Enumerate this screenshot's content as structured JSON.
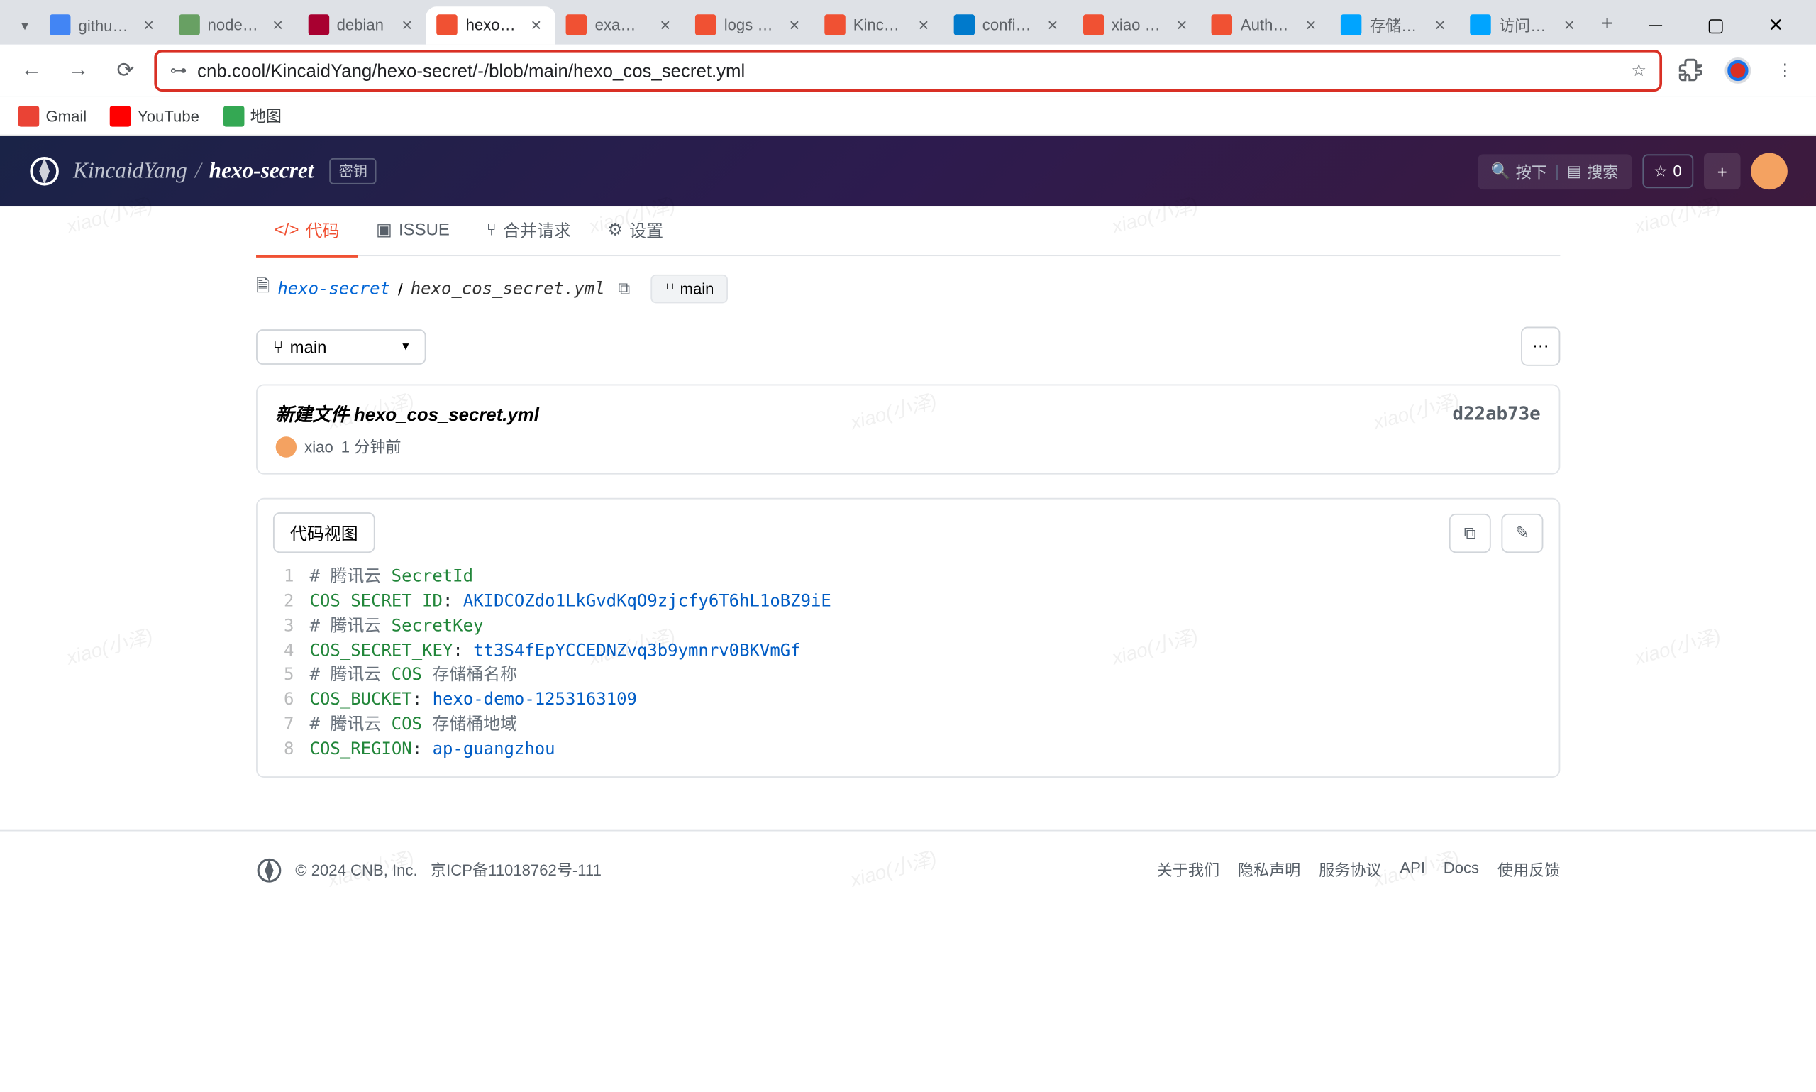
{
  "browser": {
    "tabs": [
      {
        "title": "github发",
        "favicon": "#4285f4"
      },
      {
        "title": "node Tao",
        "favicon": "#68a063"
      },
      {
        "title": "debian",
        "favicon": "#a80030"
      },
      {
        "title": "hexo co",
        "favicon": "#f05133",
        "active": true
      },
      {
        "title": "example",
        "favicon": "#f05133"
      },
      {
        "title": "logs · Kin",
        "favicon": "#f05133"
      },
      {
        "title": "KincaidY",
        "favicon": "#f05133"
      },
      {
        "title": "config.y",
        "favicon": "#007acc"
      },
      {
        "title": "xiao · re",
        "favicon": "#f05133"
      },
      {
        "title": "Authent",
        "favicon": "#f05133"
      },
      {
        "title": "存储桶列",
        "favicon": "#00a4ff"
      },
      {
        "title": "访问密钥",
        "favicon": "#00a4ff"
      }
    ],
    "url": "cnb.cool/KincaidYang/hexo-secret/-/blob/main/hexo_cos_secret.yml",
    "bookmarks": [
      {
        "label": "Gmail",
        "color": "#ea4335"
      },
      {
        "label": "YouTube",
        "color": "#ff0000"
      },
      {
        "label": "地图",
        "color": "#34a853"
      }
    ]
  },
  "header": {
    "owner": "KincaidYang",
    "repo": "hexo-secret",
    "badge": "密钥",
    "btn_down": "按下",
    "btn_search": "搜索",
    "star_count": "0"
  },
  "tabs": {
    "code": "代码",
    "issue": "ISSUE",
    "merge": "合并请求",
    "settings": "设置"
  },
  "file_path": {
    "repo": "hexo-secret",
    "file": "hexo_cos_secret.yml",
    "branch": "main"
  },
  "branch_select": "main",
  "commit": {
    "title": "新建文件 hexo_cos_secret.yml",
    "hash": "d22ab73e",
    "author": "xiao",
    "time": "1 分钟前"
  },
  "file_view": {
    "toggle": "代码视图"
  },
  "code": {
    "lines": [
      {
        "n": "1",
        "raw": "# 腾讯云 SecretId"
      },
      {
        "n": "2",
        "key": "COS_SECRET_ID",
        "val": "AKIDCOZdo1LkGvdKqO9zjcfy6T6hL1oBZ9iE"
      },
      {
        "n": "3",
        "raw": "# 腾讯云 SecretKey"
      },
      {
        "n": "4",
        "key": "COS_SECRET_KEY",
        "val": "tt3S4fEpYCCEDNZvq3b9ymnrv0BKVmGf"
      },
      {
        "n": "5",
        "raw": "# 腾讯云 COS 存储桶名称"
      },
      {
        "n": "6",
        "key": "COS_BUCKET",
        "val": "hexo-demo-1253163109"
      },
      {
        "n": "7",
        "raw": "# 腾讯云 COS 存储桶地域"
      },
      {
        "n": "8",
        "key": "COS_REGION",
        "val": "ap-guangzhou"
      }
    ]
  },
  "watermark": "xiao(小泽)",
  "footer": {
    "copyright": "© 2024 CNB, Inc.",
    "icp": "京ICP备11018762号-111",
    "links": [
      "关于我们",
      "隐私声明",
      "服务协议",
      "API",
      "Docs",
      "使用反馈"
    ]
  }
}
